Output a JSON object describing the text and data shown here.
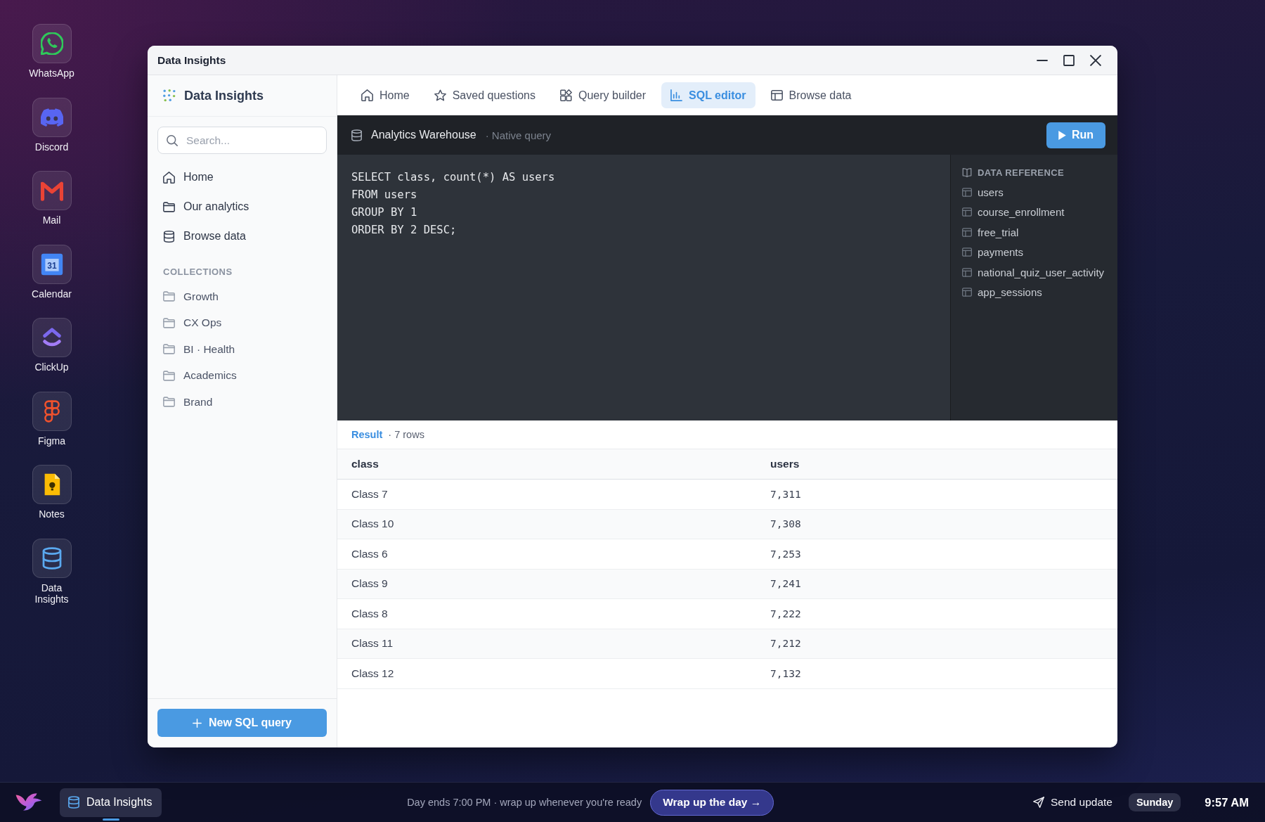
{
  "dock": [
    {
      "label": "WhatsApp",
      "kind": "chat"
    },
    {
      "label": "Discord",
      "kind": "gamepad"
    },
    {
      "label": "Mail",
      "kind": "mail"
    },
    {
      "label": "Calendar",
      "kind": "calendar",
      "icon_text": "31"
    },
    {
      "label": "ClickUp",
      "kind": "chevron"
    },
    {
      "label": "Figma",
      "kind": "shapes"
    },
    {
      "label": "Notes",
      "kind": "note"
    },
    {
      "label": "Data Insights",
      "kind": "database"
    }
  ],
  "window": {
    "title": "Data Insights"
  },
  "sidebar": {
    "brand": "Data Insights",
    "search": {
      "placeholder": "Search..."
    },
    "nav": [
      {
        "label": "Home",
        "kind": "home"
      },
      {
        "label": "Our analytics",
        "kind": "folder"
      },
      {
        "label": "Browse data",
        "kind": "database"
      }
    ],
    "collections_heading": "COLLECTIONS",
    "collections": [
      "Growth",
      "CX Ops",
      "BI · Health",
      "Academics",
      "Brand"
    ],
    "new_query_button": "New SQL query"
  },
  "tabs": [
    {
      "label": "Home",
      "kind": "home",
      "selected": false
    },
    {
      "label": "Saved questions",
      "kind": "star",
      "selected": false
    },
    {
      "label": "Query builder",
      "kind": "blocks",
      "selected": false
    },
    {
      "label": "SQL editor",
      "kind": "chart",
      "selected": true
    },
    {
      "label": "Browse data",
      "kind": "table",
      "selected": false
    }
  ],
  "editor": {
    "database": "Analytics Warehouse",
    "mode": "· Native query",
    "run_button": "Run",
    "code": [
      "SELECT class, count(*) AS users",
      "FROM users",
      "GROUP BY 1",
      "ORDER BY 2 DESC;"
    ],
    "data_reference": {
      "heading": "DATA REFERENCE",
      "tables": [
        "users",
        "course_enrollment",
        "free_trial",
        "payments",
        "national_quiz_user_activity",
        "app_sessions"
      ]
    }
  },
  "result": {
    "label": "Result",
    "count": "· 7 rows",
    "columns": [
      "class",
      "users"
    ],
    "rows": [
      [
        "Class 7",
        "7,311"
      ],
      [
        "Class 10",
        "7,308"
      ],
      [
        "Class 6",
        "7,253"
      ],
      [
        "Class 9",
        "7,241"
      ],
      [
        "Class 8",
        "7,222"
      ],
      [
        "Class 11",
        "7,212"
      ],
      [
        "Class 12",
        "7,132"
      ]
    ]
  },
  "taskbar": {
    "app": {
      "label": "Data Insights",
      "active": true
    },
    "message": "Day ends 7:00 PM · wrap up whenever you're ready",
    "wrap_button": "Wrap up the day →",
    "send_update": "Send update",
    "day": "Sunday",
    "time": "9:57 AM"
  }
}
